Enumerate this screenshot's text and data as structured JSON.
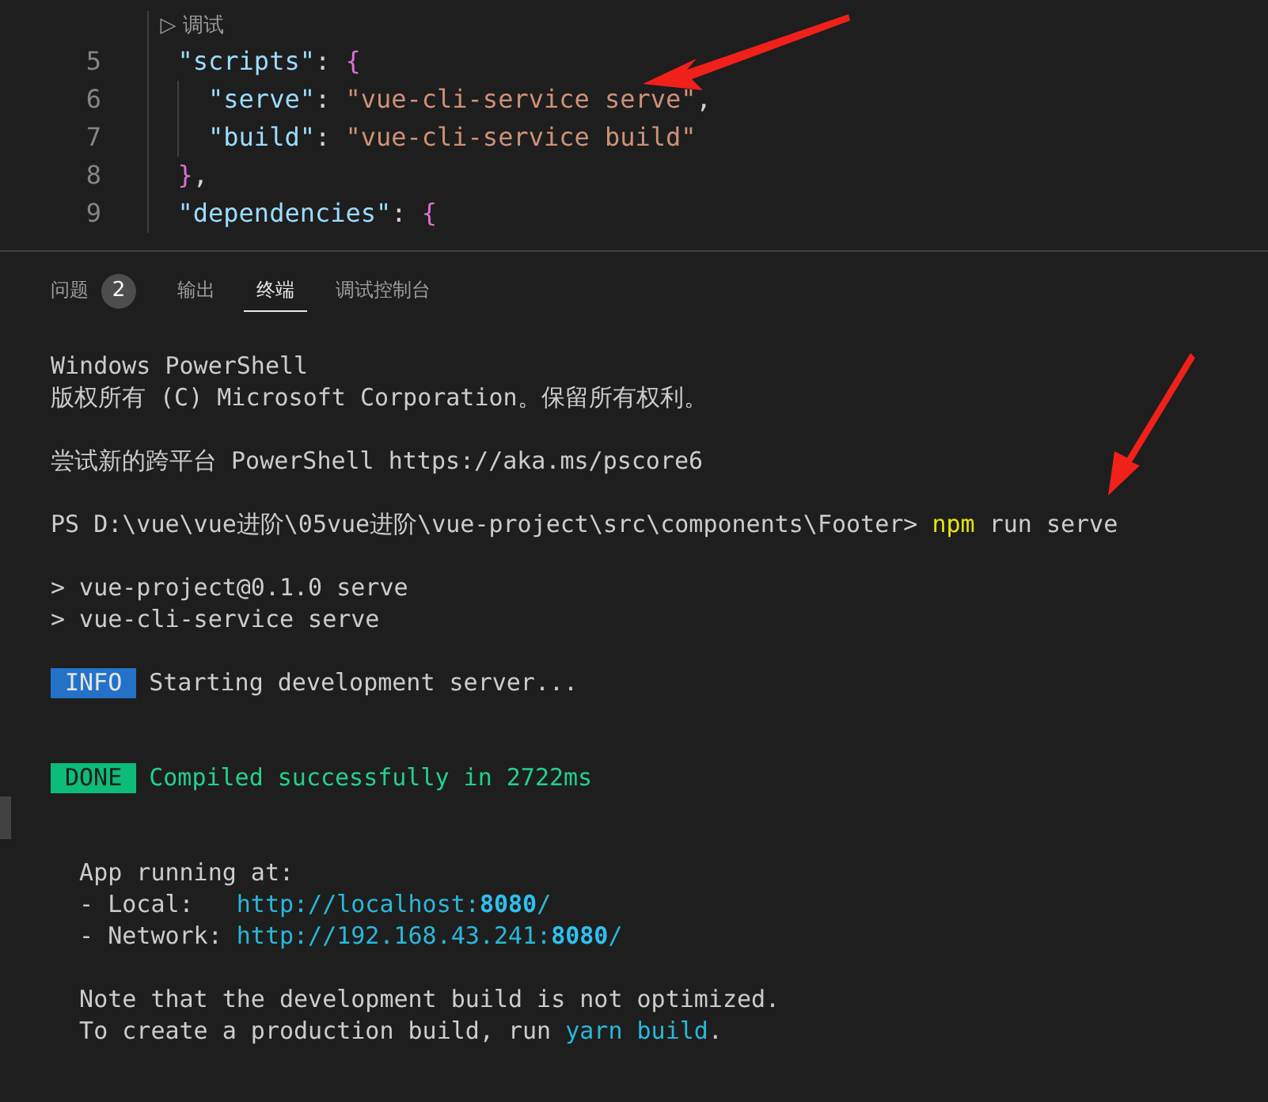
{
  "editor": {
    "lines": [
      {
        "kind": "codelens",
        "tokens": [
          {
            "kind": "lens",
            "text": "  ▷ 调试"
          }
        ]
      },
      {
        "number": "5",
        "kind": "code",
        "tokens": [
          {
            "kind": "key",
            "text": "  \"scripts\""
          },
          {
            "kind": "punct",
            "text": ": "
          },
          {
            "kind": "brace",
            "text": "{"
          }
        ]
      },
      {
        "number": "6",
        "kind": "code",
        "tokens": [
          {
            "kind": "key",
            "text": "    \"serve\""
          },
          {
            "kind": "punct",
            "text": ": "
          },
          {
            "kind": "string",
            "text": "\"vue-cli-service serve\""
          },
          {
            "kind": "punct",
            "text": ","
          }
        ]
      },
      {
        "number": "7",
        "kind": "code",
        "tokens": [
          {
            "kind": "key",
            "text": "    \"build\""
          },
          {
            "kind": "punct",
            "text": ": "
          },
          {
            "kind": "string",
            "text": "\"vue-cli-service build\""
          }
        ]
      },
      {
        "number": "8",
        "kind": "code",
        "tokens": [
          {
            "kind": "brace",
            "text": "  }"
          },
          {
            "kind": "punct",
            "text": ","
          }
        ]
      },
      {
        "number": "9",
        "kind": "code",
        "tokens": [
          {
            "kind": "key",
            "text": "  \"dependencies\""
          },
          {
            "kind": "punct",
            "text": ": "
          },
          {
            "kind": "brace",
            "text": "{"
          }
        ]
      }
    ]
  },
  "panel": {
    "tabs": [
      {
        "label": "问题",
        "badge": "2",
        "selected": false
      },
      {
        "label": "输出",
        "selected": false
      },
      {
        "label": "终端",
        "selected": true
      },
      {
        "label": "调试控制台",
        "selected": false
      }
    ]
  },
  "terminal": {
    "lines": [
      {
        "kind": "line",
        "segments": [
          {
            "kind": "text",
            "text": "Windows PowerShell"
          }
        ]
      },
      {
        "kind": "line",
        "segments": [
          {
            "kind": "text",
            "text": "版权所有 (C) Microsoft Corporation。保留所有权利。"
          }
        ]
      },
      {
        "kind": "blank"
      },
      {
        "kind": "line",
        "segments": [
          {
            "kind": "text",
            "text": "尝试新的跨平台 PowerShell https://aka.ms/pscore6"
          }
        ]
      },
      {
        "kind": "blank"
      },
      {
        "kind": "line",
        "segments": [
          {
            "kind": "text",
            "text": "PS D:\\vue\\vue进阶\\05vue进阶\\vue-project\\src\\components\\Footer> "
          },
          {
            "kind": "command",
            "text": "npm"
          },
          {
            "kind": "text",
            "text": " run serve"
          }
        ]
      },
      {
        "kind": "blank"
      },
      {
        "kind": "line",
        "segments": [
          {
            "kind": "text",
            "text": "> vue-project@0.1.0 serve"
          }
        ]
      },
      {
        "kind": "line",
        "segments": [
          {
            "kind": "text",
            "text": "> vue-cli-service serve"
          }
        ]
      },
      {
        "kind": "blank"
      },
      {
        "kind": "line",
        "segments": [
          {
            "kind": "info",
            "text": "INFO"
          },
          {
            "kind": "text",
            "text": "Starting development server..."
          }
        ]
      },
      {
        "kind": "blank"
      },
      {
        "kind": "blank"
      },
      {
        "kind": "line",
        "segments": [
          {
            "kind": "done",
            "text": "DONE"
          },
          {
            "kind": "success",
            "text": "Compiled successfully in 2722ms"
          }
        ]
      },
      {
        "kind": "blank"
      },
      {
        "kind": "blank"
      },
      {
        "kind": "line",
        "segments": [
          {
            "kind": "text",
            "text": "  App running at:"
          }
        ]
      },
      {
        "kind": "line",
        "segments": [
          {
            "kind": "text",
            "text": "  - Local:   "
          },
          {
            "kind": "link",
            "text": "http://localhost:**8080**/"
          }
        ]
      },
      {
        "kind": "line",
        "segments": [
          {
            "kind": "text",
            "text": "  - Network: "
          },
          {
            "kind": "link",
            "text": "http://192.168.43.241:**8080**/"
          }
        ]
      },
      {
        "kind": "blank"
      },
      {
        "kind": "line",
        "segments": [
          {
            "kind": "text",
            "text": "  Note that the development build is not optimized."
          }
        ]
      },
      {
        "kind": "line",
        "segments": [
          {
            "kind": "text",
            "text": "  To create a production build, run "
          },
          {
            "kind": "link",
            "text": "yarn build"
          },
          {
            "kind": "text",
            "text": "."
          }
        ]
      }
    ]
  }
}
